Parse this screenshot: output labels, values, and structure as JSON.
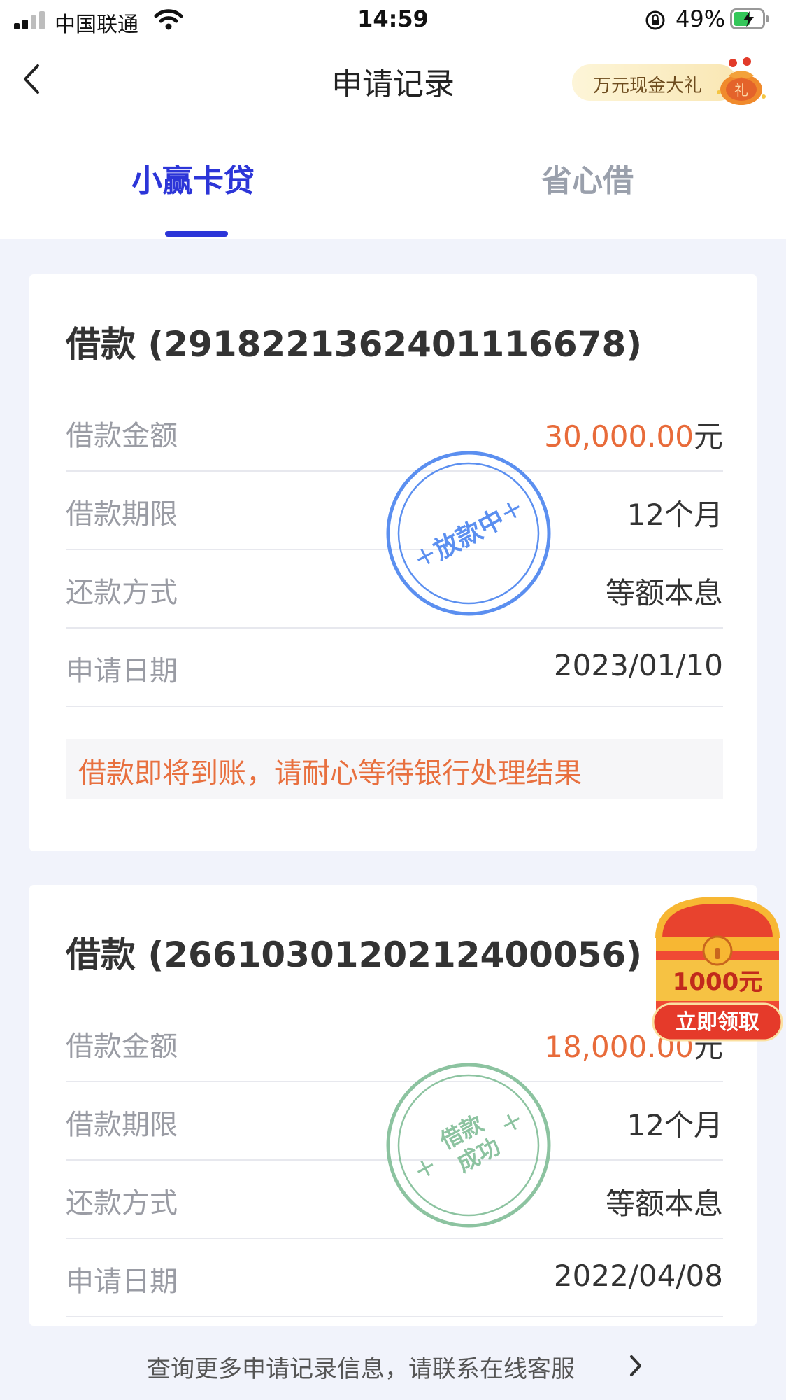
{
  "status_bar": {
    "carrier": "中国联通",
    "time": "14:59",
    "battery_percent": "49%",
    "icons": [
      "signal-icon",
      "wifi-icon",
      "rotation-lock-icon",
      "battery-charging-icon"
    ]
  },
  "nav": {
    "title": "申请记录",
    "promo_label": "万元现金大礼",
    "promo_badge": "礼",
    "back_icon": "chevron-left-icon"
  },
  "tabs": [
    {
      "label": "小赢卡贷",
      "active": true
    },
    {
      "label": "省心借",
      "active": false
    }
  ],
  "loans": [
    {
      "title": "借款 (2918221362401116678)",
      "rows": [
        {
          "label": "借款金额",
          "value": "30,000.00",
          "unit": "元"
        },
        {
          "label": "借款期限",
          "value": "12个月"
        },
        {
          "label": "还款方式",
          "value": "等额本息"
        },
        {
          "label": "申请日期",
          "value": "2023/01/10"
        }
      ],
      "stamp": "放款中",
      "stamp_color": "#5b8ff0",
      "notice": "借款即将到账，请耐心等待银行处理结果"
    },
    {
      "title": "借款 (2661030120212400056)",
      "rows": [
        {
          "label": "借款金额",
          "value": "18,000.00",
          "unit": "元"
        },
        {
          "label": "借款期限",
          "value": "12个月"
        },
        {
          "label": "还款方式",
          "value": "等额本息"
        },
        {
          "label": "申请日期",
          "value": "2022/04/08"
        }
      ],
      "stamp_line1": "借款",
      "stamp_line2": "成功",
      "stamp_color": "#8cc3a0"
    }
  ],
  "promo_chest": {
    "amount": "1000元",
    "button": "立即领取"
  },
  "footer": {
    "text": "查询更多申请记录信息，请联系在线客服",
    "icon": "chevron-right-icon"
  },
  "colors": {
    "accent": "#2c35d8",
    "amount": "#e86b3a",
    "notice": "#e8703f",
    "background": "#f1f3fb"
  }
}
